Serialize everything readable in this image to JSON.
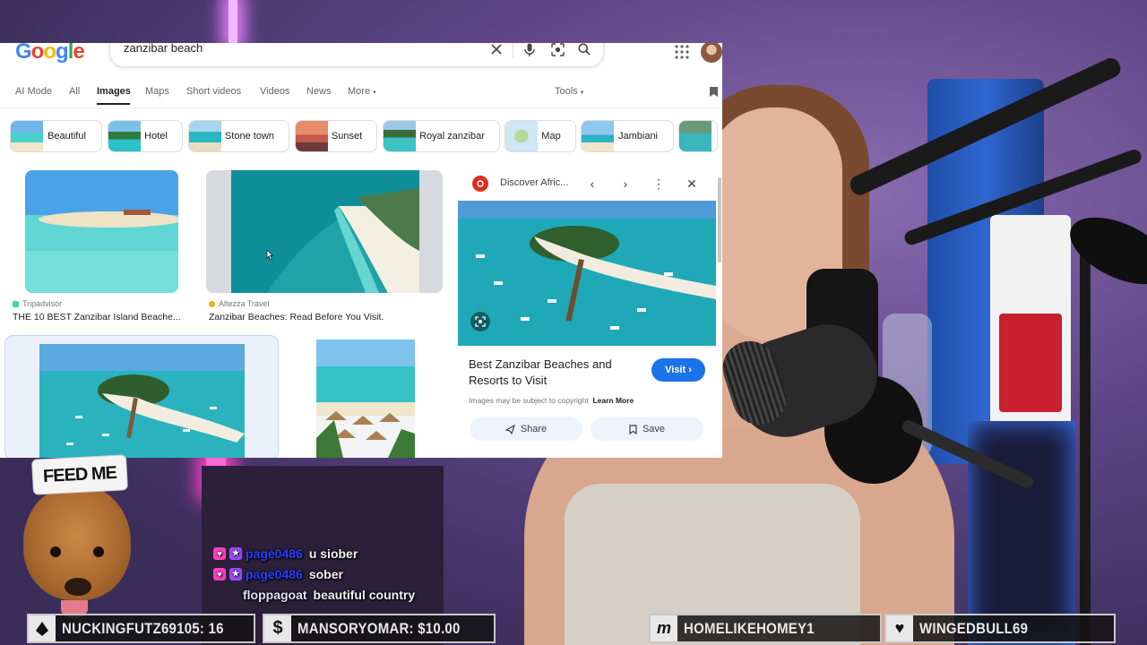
{
  "google": {
    "logo_text": "Google",
    "search_query": "zanzibar beach",
    "nav_tabs": [
      "AI Mode",
      "All",
      "Images",
      "Maps",
      "Short videos",
      "Videos",
      "News",
      "More"
    ],
    "active_tab": "Images",
    "tools_label": "Tools",
    "chips": [
      {
        "label": "Beautiful"
      },
      {
        "label": "Hotel"
      },
      {
        "label": "Stone town"
      },
      {
        "label": "Sunset"
      },
      {
        "label": "Royal zanzibar"
      },
      {
        "label": "Map"
      },
      {
        "label": "Jambiani"
      }
    ],
    "results": [
      {
        "source": "Tripadvisor",
        "title": "THE 10 BEST Zanzibar Island Beache..."
      },
      {
        "source": "Altezza Travel",
        "title": "Zanzibar Beaches: Read Before You Visit."
      }
    ],
    "panel": {
      "source_name": "Discover Afric...",
      "title": "Best Zanzibar Beaches and Resorts to Visit",
      "visit_label": "Visit",
      "copyright_text": "Images may be subject to copyright",
      "learn_more": "Learn More",
      "share_label": "Share",
      "save_label": "Save"
    }
  },
  "stream": {
    "dog_hat_text": "FEED ME",
    "chat": [
      {
        "user": "page0486",
        "message": "u siober",
        "badges": true,
        "name_color": "#2c3cff"
      },
      {
        "user": "page0486",
        "message": "sober",
        "badges": true,
        "name_color": "#2c3cff"
      },
      {
        "user": "floppagoat",
        "message": "beautiful country",
        "badges": false,
        "name_color": "#e0e0ff"
      }
    ],
    "alerts": [
      {
        "icon": "bits-icon",
        "text": "NUCKINGFUTZ69105: 16"
      },
      {
        "icon": "dollar-icon",
        "text": "MANSORYOMAR: $10.00"
      },
      {
        "icon": "m-icon",
        "text": "HOMELIKEHOMEY1"
      },
      {
        "icon": "heart-icon",
        "text": "WINGEDBULL69"
      }
    ]
  },
  "colors": {
    "google_blue": "#1a73e8",
    "chat_heart_badge": "#ff3fc0",
    "chat_sub_badge": "#9b4dff"
  }
}
